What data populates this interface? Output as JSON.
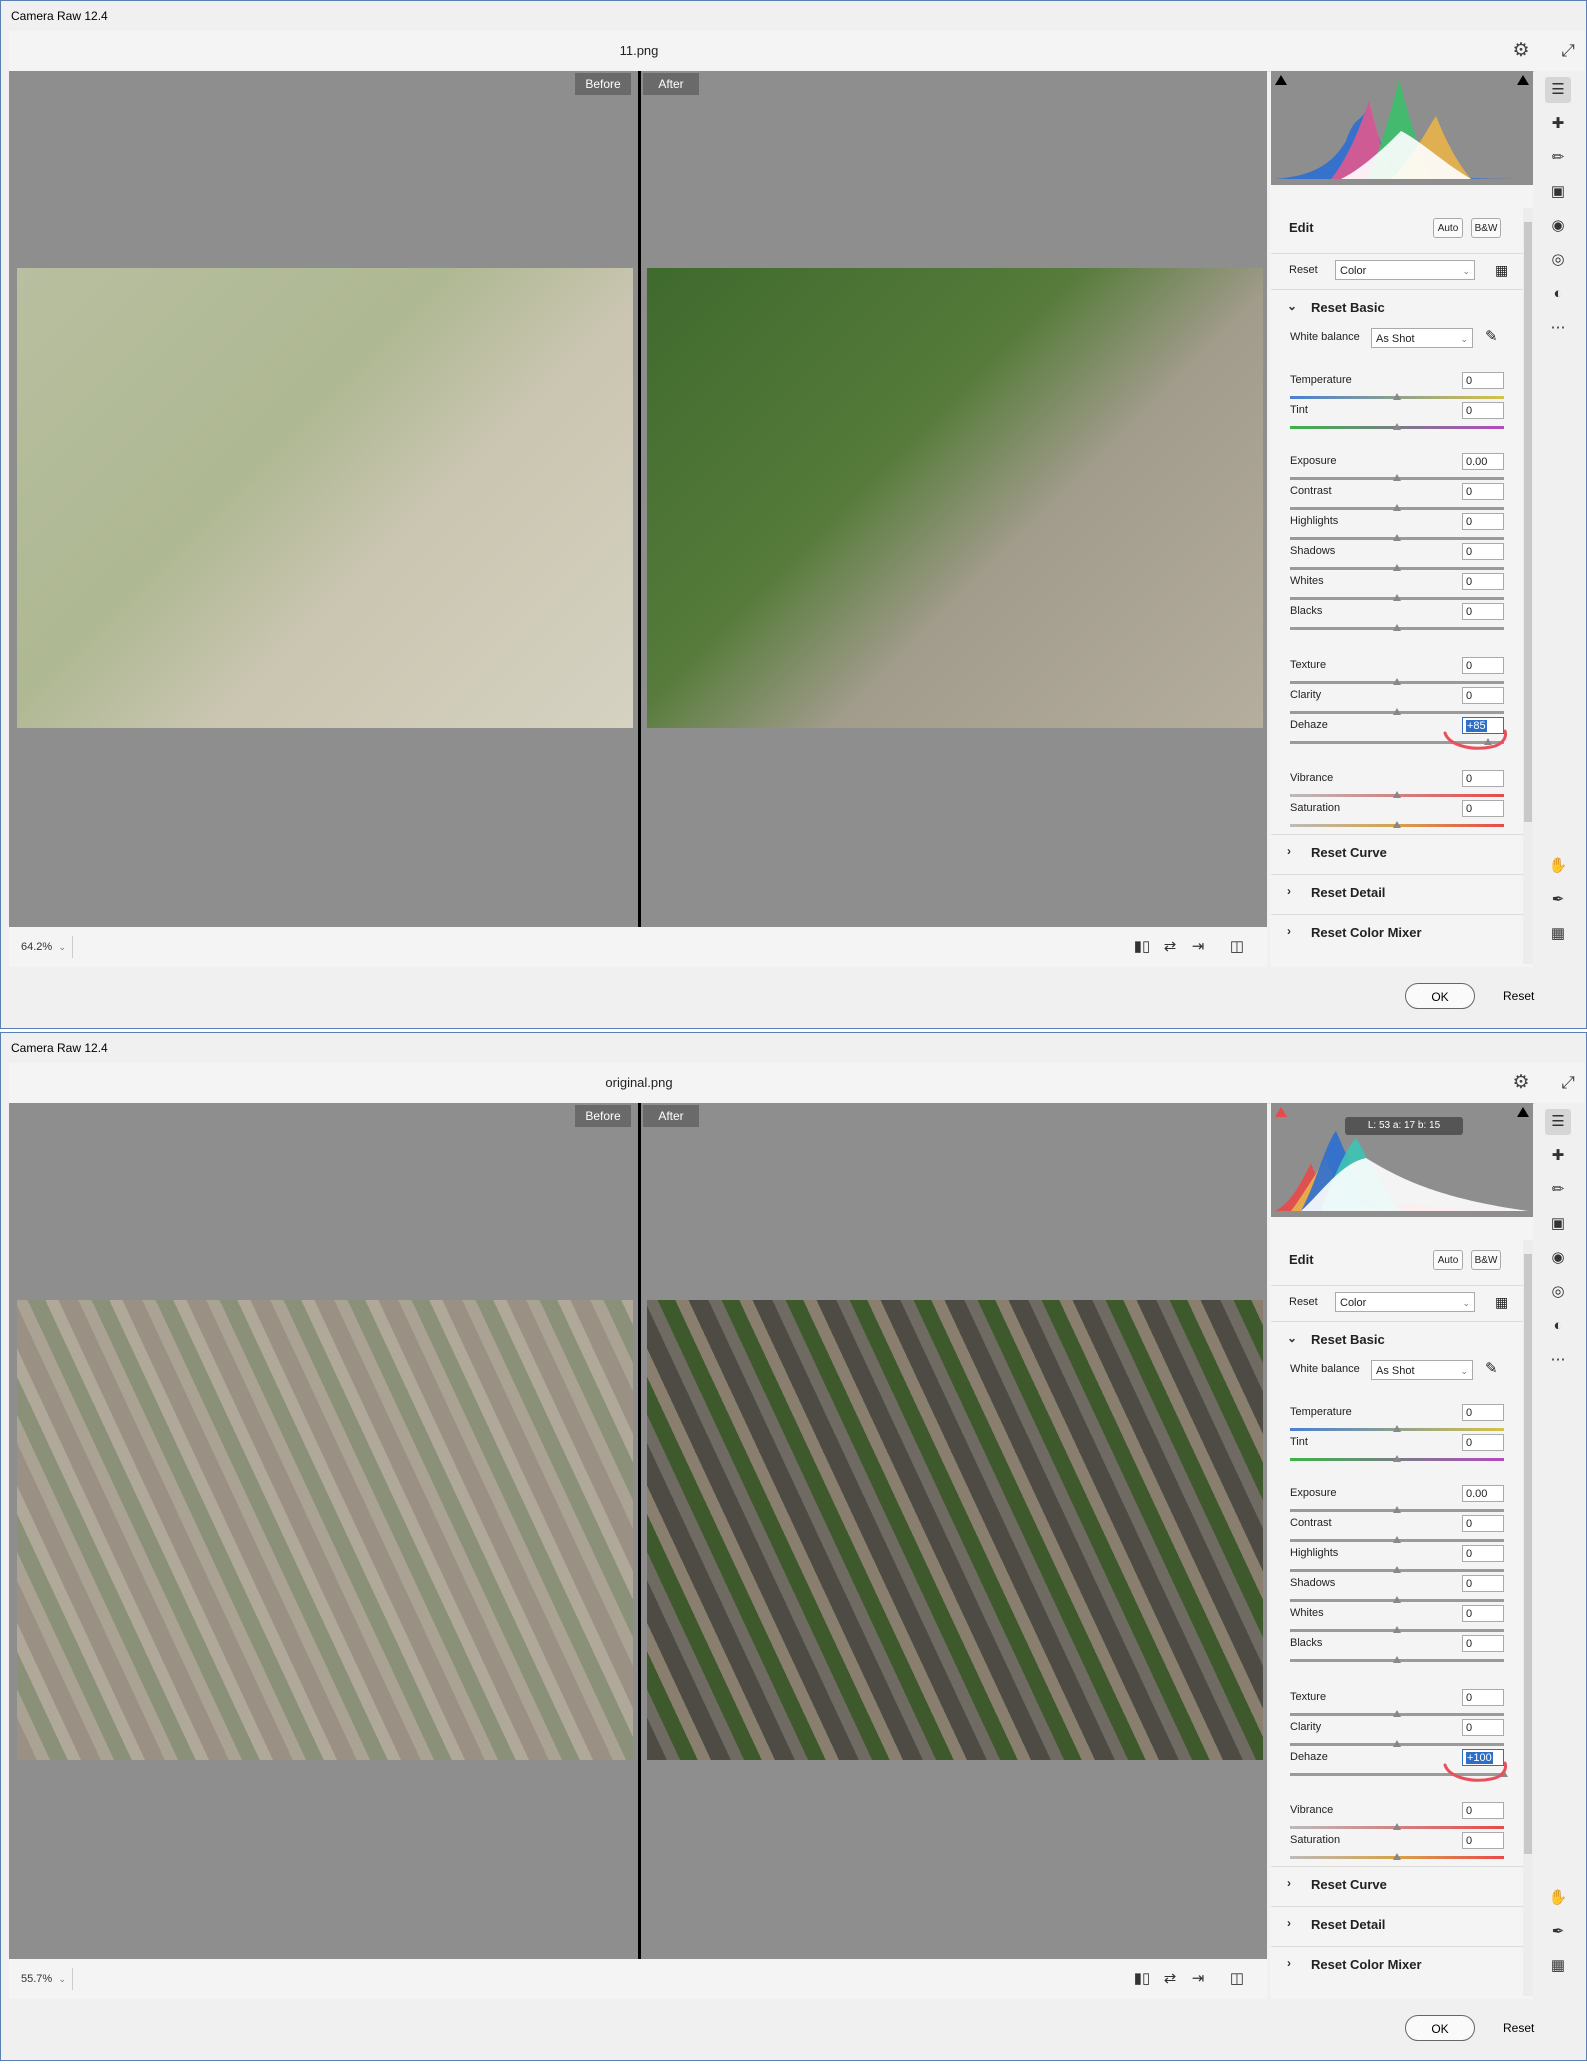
{
  "windows": [
    {
      "title": "Camera Raw 12.4",
      "doc_name": "11.png",
      "before_label": "Before",
      "after_label": "After",
      "zoom": "64.2%",
      "histogram_readout": "",
      "edit": {
        "title": "Edit",
        "auto": "Auto",
        "bw": "B&W",
        "reset_label": "Reset",
        "profile": "Color",
        "basic_section": "Reset Basic",
        "white_balance_label": "White balance",
        "white_balance_value": "As Shot"
      },
      "sliders": [
        {
          "label": "Temperature",
          "value": "0",
          "level": 0.5
        },
        {
          "label": "Tint",
          "value": "0",
          "level": 0.5
        },
        {
          "label": "Exposure",
          "value": "0.00",
          "level": 0.5
        },
        {
          "label": "Contrast",
          "value": "0",
          "level": 0.5
        },
        {
          "label": "Highlights",
          "value": "0",
          "level": 0.5
        },
        {
          "label": "Shadows",
          "value": "0",
          "level": 0.5
        },
        {
          "label": "Whites",
          "value": "0",
          "level": 0.5
        },
        {
          "label": "Blacks",
          "value": "0",
          "level": 0.5
        },
        {
          "label": "Texture",
          "value": "0",
          "level": 0.5
        },
        {
          "label": "Clarity",
          "value": "0",
          "level": 0.5
        },
        {
          "label": "Dehaze",
          "value": "+85",
          "level": 0.925
        },
        {
          "label": "Vibrance",
          "value": "0",
          "level": 0.5
        },
        {
          "label": "Saturation",
          "value": "0",
          "level": 0.5
        }
      ],
      "sections": [
        "Reset Curve",
        "Reset Detail",
        "Reset Color Mixer"
      ],
      "ok": "OK",
      "reset": "Reset"
    },
    {
      "title": "Camera Raw 12.4",
      "doc_name": "original.png",
      "before_label": "Before",
      "after_label": "After",
      "zoom": "55.7%",
      "histogram_readout": "L: 53    a: 17    b: 15",
      "edit": {
        "title": "Edit",
        "auto": "Auto",
        "bw": "B&W",
        "reset_label": "Reset",
        "profile": "Color",
        "basic_section": "Reset Basic",
        "white_balance_label": "White balance",
        "white_balance_value": "As Shot"
      },
      "sliders": [
        {
          "label": "Temperature",
          "value": "0",
          "level": 0.5
        },
        {
          "label": "Tint",
          "value": "0",
          "level": 0.5
        },
        {
          "label": "Exposure",
          "value": "0.00",
          "level": 0.5
        },
        {
          "label": "Contrast",
          "value": "0",
          "level": 0.5
        },
        {
          "label": "Highlights",
          "value": "0",
          "level": 0.5
        },
        {
          "label": "Shadows",
          "value": "0",
          "level": 0.5
        },
        {
          "label": "Whites",
          "value": "0",
          "level": 0.5
        },
        {
          "label": "Blacks",
          "value": "0",
          "level": 0.5
        },
        {
          "label": "Texture",
          "value": "0",
          "level": 0.5
        },
        {
          "label": "Clarity",
          "value": "0",
          "level": 0.5
        },
        {
          "label": "Dehaze",
          "value": "+100",
          "level": 1.0
        },
        {
          "label": "Vibrance",
          "value": "0",
          "level": 0.5
        },
        {
          "label": "Saturation",
          "value": "0",
          "level": 0.5
        }
      ],
      "sections": [
        "Reset Curve",
        "Reset Detail",
        "Reset Color Mixer"
      ],
      "ok": "OK",
      "reset": "Reset"
    }
  ],
  "icons": {
    "gear": "⚙",
    "expand": "⤢",
    "chevron_down": "⌄",
    "chevron_right": "›",
    "eyedropper": "✎",
    "profile_browser": "▦",
    "compare": "▮▯",
    "swap": "⇄",
    "copy": "⇥",
    "toggle": "◫",
    "hand": "✋",
    "color_sampler": "✒",
    "grid": "▦"
  },
  "colors": {
    "accent": "#2f6ec7",
    "annotation": "#e8505b"
  }
}
